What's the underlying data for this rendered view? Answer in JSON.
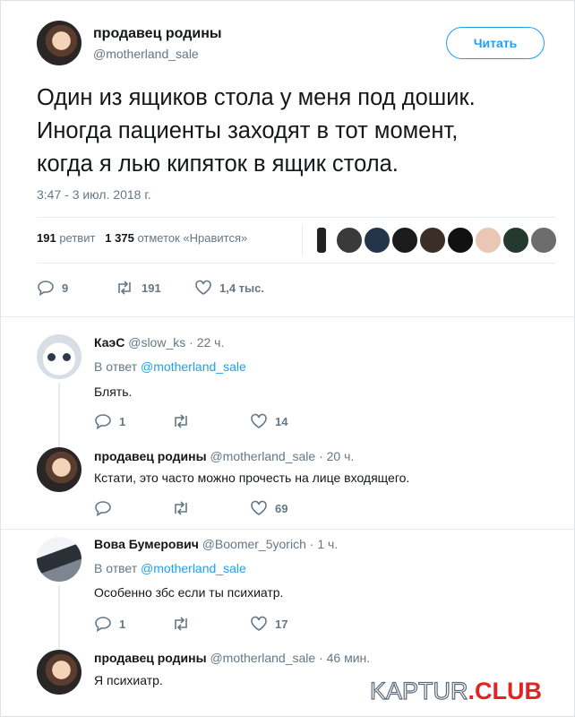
{
  "author": {
    "name": "продавец родины",
    "handle": "@motherland_sale"
  },
  "follow_label": "Читать",
  "tweet": {
    "lines": [
      "Один из ящиков стола у меня под дошик.",
      "Иногда пациенты заходят в тот момент,",
      "когда я лью кипяток в ящик стола."
    ],
    "time": "3:47 - 3 июл. 2018 г.",
    "retweets_count": "191",
    "retweets_label": "ретвит",
    "likes_count": "1 375",
    "likes_label": "отметок «Нравится»",
    "actions": {
      "replies": "9",
      "retweets": "191",
      "likes": "1,4 тыс."
    }
  },
  "replies": [
    {
      "name": "КаэС",
      "handle": "@slow_ks",
      "time": "· 22 ч.",
      "reply_prefix": "В ответ",
      "reply_to": "@motherland_sale",
      "text": "Блять.",
      "actions": {
        "replies": "1",
        "retweets": "",
        "likes": "14"
      }
    },
    {
      "name": "продавец родины",
      "handle": "@motherland_sale",
      "time": "· 20 ч.",
      "text": "Кстати, это часто можно прочесть на лице входящего.",
      "actions": {
        "replies": "",
        "retweets": "",
        "likes": "69"
      }
    },
    {
      "name": "Вова Бумерович",
      "handle": "@Boomer_5yorich",
      "time": "· 1 ч.",
      "reply_prefix": "В ответ",
      "reply_to": "@motherland_sale",
      "text": "Особенно збс если ты психиатр.",
      "actions": {
        "replies": "1",
        "retweets": "",
        "likes": "17"
      }
    },
    {
      "name": "продавец родины",
      "handle": "@motherland_sale",
      "time": "· 46 мин.",
      "text": "Я психиатр."
    }
  ],
  "watermark": {
    "part1": "KAPTUR",
    "part2": ".CLUB"
  },
  "colors": {
    "accent": "#1da1f2",
    "muted": "#657786",
    "text": "#14171a",
    "watermark_red": "#e52121"
  },
  "icons": [
    "reply-icon",
    "retweet-icon",
    "heart-icon"
  ]
}
